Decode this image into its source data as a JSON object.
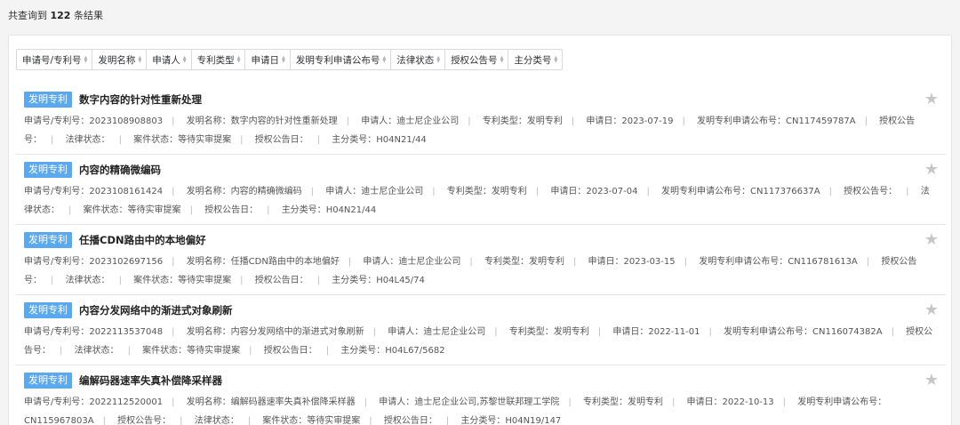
{
  "summary": {
    "prefix": "共查询到",
    "count": "122",
    "suffix": "条结果"
  },
  "sort_fields": [
    "申请号/专利号",
    "发明名称",
    "申请人",
    "专利类型",
    "申请日",
    "发明专利申请公布号",
    "法律状态",
    "授权公告号",
    "主分类号"
  ],
  "colors": {
    "tag": "#5aa9ee",
    "star": "#c6c6c6"
  },
  "results": [
    {
      "tag": "发明专利",
      "title": "数字内容的针对性重新处理",
      "fields": [
        {
          "label": "申请号/专利号：",
          "value": "2023108908803"
        },
        {
          "label": "发明名称：",
          "value": "数字内容的针对性重新处理"
        },
        {
          "label": "申请人：",
          "value": "迪士尼企业公司"
        },
        {
          "label": "专利类型：",
          "value": "发明专利"
        },
        {
          "label": "申请日：",
          "value": "2023-07-19"
        },
        {
          "label": "发明专利申请公布号：",
          "value": "CN117459787A"
        },
        {
          "label": "授权公告号：",
          "value": ""
        },
        {
          "label": "法律状态：",
          "value": ""
        },
        {
          "label": "案件状态：",
          "value": "等待实审提案"
        },
        {
          "label": "授权公告日：",
          "value": ""
        },
        {
          "label": "主分类号：",
          "value": "H04N21/44"
        }
      ]
    },
    {
      "tag": "发明专利",
      "title": "内容的精确微编码",
      "fields": [
        {
          "label": "申请号/专利号：",
          "value": "2023108161424"
        },
        {
          "label": "发明名称：",
          "value": "内容的精确微编码"
        },
        {
          "label": "申请人：",
          "value": "迪士尼企业公司"
        },
        {
          "label": "专利类型：",
          "value": "发明专利"
        },
        {
          "label": "申请日：",
          "value": "2023-07-04"
        },
        {
          "label": "发明专利申请公布号：",
          "value": "CN117376637A"
        },
        {
          "label": "授权公告号：",
          "value": ""
        },
        {
          "label": "法律状态：",
          "value": ""
        },
        {
          "label": "案件状态：",
          "value": "等待实审提案"
        },
        {
          "label": "授权公告日：",
          "value": ""
        },
        {
          "label": "主分类号：",
          "value": "H04N21/44"
        }
      ]
    },
    {
      "tag": "发明专利",
      "title": "任播CDN路由中的本地偏好",
      "fields": [
        {
          "label": "申请号/专利号：",
          "value": "2023102697156"
        },
        {
          "label": "发明名称：",
          "value": "任播CDN路由中的本地偏好"
        },
        {
          "label": "申请人：",
          "value": "迪士尼企业公司"
        },
        {
          "label": "专利类型：",
          "value": "发明专利"
        },
        {
          "label": "申请日：",
          "value": "2023-03-15"
        },
        {
          "label": "发明专利申请公布号：",
          "value": "CN116781613A"
        },
        {
          "label": "授权公告号：",
          "value": ""
        },
        {
          "label": "法律状态：",
          "value": ""
        },
        {
          "label": "案件状态：",
          "value": "等待实审提案"
        },
        {
          "label": "授权公告日：",
          "value": ""
        },
        {
          "label": "主分类号：",
          "value": "H04L45/74"
        }
      ]
    },
    {
      "tag": "发明专利",
      "title": "内容分发网络中的渐进式对象刷新",
      "fields": [
        {
          "label": "申请号/专利号：",
          "value": "2022113537048"
        },
        {
          "label": "发明名称：",
          "value": "内容分发网络中的渐进式对象刷新"
        },
        {
          "label": "申请人：",
          "value": "迪士尼企业公司"
        },
        {
          "label": "专利类型：",
          "value": "发明专利"
        },
        {
          "label": "申请日：",
          "value": "2022-11-01"
        },
        {
          "label": "发明专利申请公布号：",
          "value": "CN116074382A"
        },
        {
          "label": "授权公告号：",
          "value": ""
        },
        {
          "label": "法律状态：",
          "value": ""
        },
        {
          "label": "案件状态：",
          "value": "等待实审提案"
        },
        {
          "label": "授权公告日：",
          "value": ""
        },
        {
          "label": "主分类号：",
          "value": "H04L67/5682"
        }
      ]
    },
    {
      "tag": "发明专利",
      "title": "编解码器速率失真补偿降采样器",
      "fields": [
        {
          "label": "申请号/专利号：",
          "value": "2022112520001"
        },
        {
          "label": "发明名称：",
          "value": "编解码器速率失真补偿降采样器"
        },
        {
          "label": "申请人：",
          "value": "迪士尼企业公司,苏黎世联邦理工学院"
        },
        {
          "label": "专利类型：",
          "value": "发明专利"
        },
        {
          "label": "申请日：",
          "value": "2022-10-13"
        },
        {
          "label": "发明专利申请公布号：",
          "value": "CN115967803A"
        },
        {
          "label": "授权公告号：",
          "value": ""
        },
        {
          "label": "法律状态：",
          "value": ""
        },
        {
          "label": "案件状态：",
          "value": "等待实审提案"
        },
        {
          "label": "授权公告日：",
          "value": ""
        },
        {
          "label": "主分类号：",
          "value": "H04N19/147"
        }
      ]
    }
  ]
}
